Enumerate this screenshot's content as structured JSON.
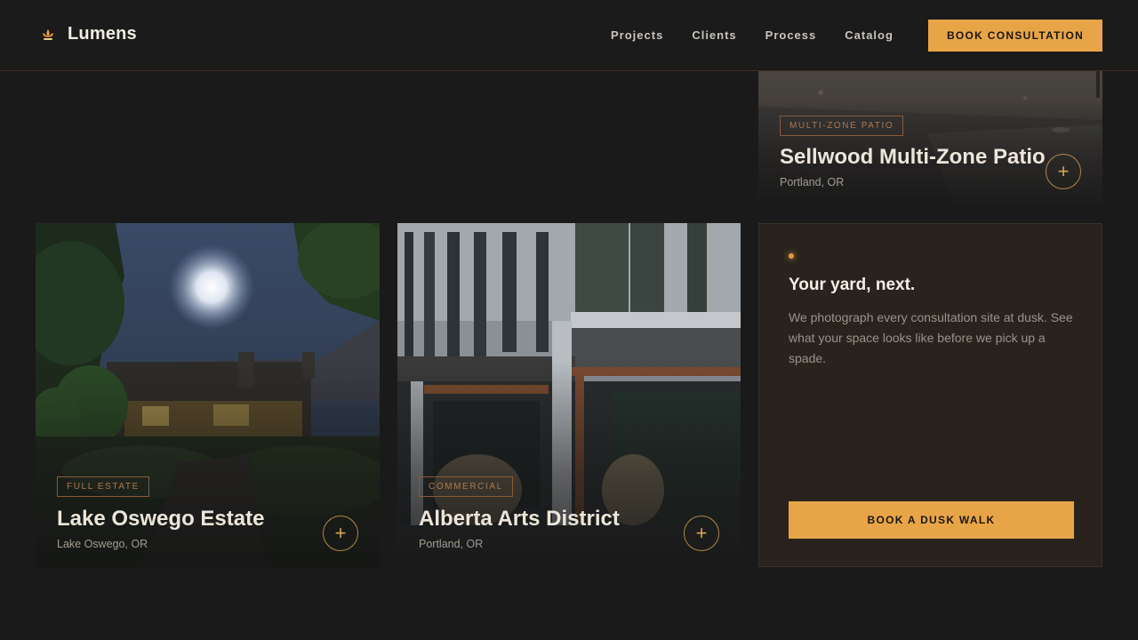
{
  "brand": {
    "name": "Lumens",
    "icon": "lotus-lamp-icon",
    "accent": "#e8a547"
  },
  "nav": {
    "items": [
      "Projects",
      "Clients",
      "Process",
      "Catalog"
    ]
  },
  "header": {
    "cta_label": "BOOK CONSULTATION"
  },
  "cards": [
    {
      "tag": "MULTI-ZONE PATIO",
      "title": "Sellwood Multi-Zone Patio",
      "location": "Portland, OR",
      "image": "night patio stone ground"
    },
    {
      "tag": "FULL ESTATE",
      "title": "Lake Oswego Estate",
      "location": "Lake Oswego, OR",
      "image": "moonlit estate garden"
    },
    {
      "tag": "COMMERCIAL",
      "title": "Alberta Arts District",
      "location": "Portland, OR",
      "image": "commercial building facade with grasses"
    }
  ],
  "promo": {
    "title": "Your yard, next.",
    "text": "We photograph every consultation site at dusk. See what your space looks like before we pick up a spade.",
    "button_label": "BOOK A DUSK WALK"
  }
}
